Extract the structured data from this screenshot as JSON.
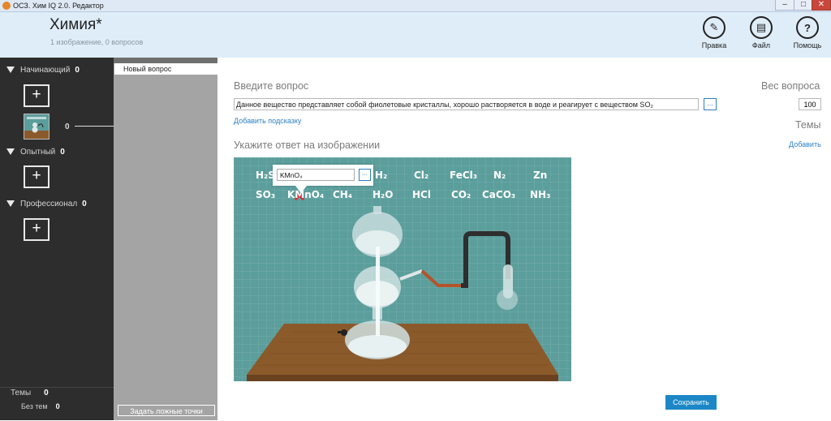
{
  "window": {
    "title": "ОСЗ. Хим IQ 2.0. Редактор",
    "minimize": "–",
    "maximize": "□",
    "close": "✕"
  },
  "header": {
    "title": "Химия*",
    "subtitle": "1 изображение, 0 вопросов",
    "tools": [
      {
        "label": "Правка",
        "icon": "pencil-icon",
        "glyph": "✎"
      },
      {
        "label": "Файл",
        "icon": "document-icon",
        "glyph": "▤"
      },
      {
        "label": "Помощь",
        "icon": "help-icon",
        "glyph": "?"
      }
    ]
  },
  "sidebar": {
    "levels": [
      {
        "name": "Начинающий",
        "count": "0"
      },
      {
        "name": "Опытный",
        "count": "0"
      },
      {
        "name": "Профессионал",
        "count": "0"
      }
    ],
    "add_label": "+",
    "thumb_count": "0",
    "topics_label": "Темы",
    "topics_count": "0",
    "no_topics_label": "Без тем",
    "no_topics_count": "0"
  },
  "questions": {
    "items": [
      "Новый вопрос"
    ],
    "fake_points_button": "Задать ложные точки"
  },
  "editor": {
    "question_label": "Введите вопрос",
    "question_text": "Данное вещество представляет собой фиолетовые кристаллы, хорошо растворяется в воде и реагирует с веществом SO₂",
    "dots_label": "...",
    "add_hint": "Добавить подсказку",
    "answer_label": "Укажите ответ на изображении",
    "weight_label": "Вес вопроса",
    "weight_value": "100",
    "topics_label": "Темы",
    "add_topic": "Добавить",
    "save": "Сохранить"
  },
  "answer_image": {
    "popup_value": "KMnO₄",
    "popup_btn": "...",
    "formulas_row1": [
      "H₂S",
      "H₂",
      "Cl₂",
      "FeCl₃",
      "N₂",
      "Zn"
    ],
    "formulas_row2": [
      "SO₃",
      "KMnO₄",
      "CH₄",
      "H₂O",
      "HCl",
      "CO₂",
      "CaCO₃",
      "NH₃"
    ]
  },
  "colors": {
    "accent": "#1b87c7",
    "sidebar_bg": "#2d2d2d",
    "header_bg": "#dfedf9",
    "board": "#5b9e9c",
    "table_wood": "#8b5a2b"
  }
}
